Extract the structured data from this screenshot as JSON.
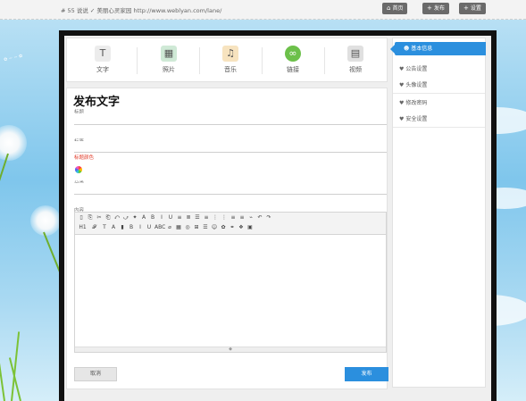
{
  "topbar": {
    "site_text": "# 55 说说 ✓ 美丽心灵家园 http://www.weblyan.com/lane/",
    "buttons": [
      {
        "label": "首页"
      },
      {
        "label": "发布"
      },
      {
        "label": "设置"
      }
    ]
  },
  "post_types": [
    {
      "label": "文字",
      "icon": "text-icon",
      "color": "#e8e8e8",
      "glyph": "T"
    },
    {
      "label": "照片",
      "icon": "photo-icon",
      "color": "#cfe9d6",
      "glyph": "▦"
    },
    {
      "label": "音乐",
      "icon": "music-icon",
      "color": "#f7e3bf",
      "glyph": "♫"
    },
    {
      "label": "链接",
      "icon": "link-icon",
      "color": "#6cc04a",
      "glyph": "∞"
    },
    {
      "label": "视频",
      "icon": "video-icon",
      "color": "#e0e0e0",
      "glyph": "▤"
    }
  ],
  "form": {
    "title": "发布文字",
    "field_title_label": "标题",
    "field_tags_label": "标签",
    "color_note": "标题颜色",
    "field_category_label": "分类",
    "field_content_label": "内容",
    "cancel_label": "取消",
    "publish_label": "发布"
  },
  "editor": {
    "row1": [
      "▯",
      "⎘",
      "✂",
      "⎗",
      "⤺",
      "⤻",
      "✦",
      "A",
      "B",
      "I",
      "U",
      "≡",
      "≣",
      "☰",
      "≡",
      "⋮",
      "⋮",
      "≡",
      "≡",
      "⌁",
      "↶",
      "↷"
    ],
    "row2": [
      "H1",
      "𝓕",
      "T",
      "A",
      "▮",
      "B",
      "I",
      "U",
      "ABC",
      "⌀",
      "▦",
      "◎",
      "⊞",
      "☰",
      "☺",
      "✿",
      "⚭",
      "❖",
      "▣"
    ],
    "resize_glyph": "◆"
  },
  "sidebar": {
    "active": "基本信息",
    "groups": [
      [
        "公告设置",
        "头像设置"
      ],
      [
        "修改密码",
        "安全设置"
      ]
    ]
  },
  "colors": {
    "accent": "#2b8fde",
    "frame": "#111111"
  }
}
